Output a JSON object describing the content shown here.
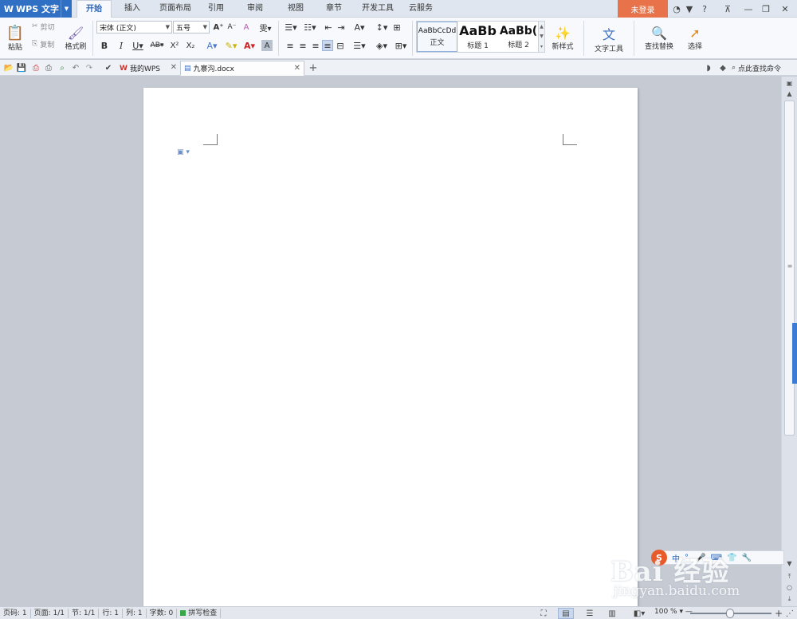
{
  "app": {
    "name": "WPS 文字",
    "login": "未登录"
  },
  "menu": {
    "tabs": [
      {
        "label": "开始",
        "active": true
      },
      {
        "label": "插入"
      },
      {
        "label": "页面布局"
      },
      {
        "label": "引用"
      },
      {
        "label": "审阅"
      },
      {
        "label": "视图"
      },
      {
        "label": "章节"
      },
      {
        "label": "开发工具"
      },
      {
        "label": "云服务"
      }
    ]
  },
  "ribbon": {
    "paste": "粘贴",
    "cut": "剪切",
    "copy": "复制",
    "format_painter": "格式刷",
    "font_name": "宋体 (正文)",
    "font_size": "五号",
    "styles": [
      {
        "preview": "AaBbCcDd",
        "label": "正文"
      },
      {
        "preview": "AaBb",
        "label": "标题 1"
      },
      {
        "preview": "AaBb(",
        "label": "标题 2"
      }
    ],
    "new_style": "新样式",
    "text_tools": "文字工具",
    "find_replace": "查找替换",
    "select": "选择"
  },
  "doc_tabs": [
    {
      "label": "我的WPS",
      "active": false
    },
    {
      "label": "九寨沟.docx",
      "active": true
    }
  ],
  "find_command": "点此查找命令",
  "ime": {
    "mode": "中"
  },
  "watermark": {
    "main": "Bai 经验",
    "sub": "jingyan.baidu.com"
  },
  "status": {
    "page_num": "页码: 1",
    "pages": "页面: 1/1",
    "section": "节: 1/1",
    "row": "行: 1",
    "col": "列: 1",
    "word_count": "字数: 0",
    "spell_check": "拼写检查",
    "zoom": "100 %"
  },
  "colors": {
    "accent": "#2f6fc4",
    "login": "#e8734a",
    "workspace": "#c5cad3"
  }
}
